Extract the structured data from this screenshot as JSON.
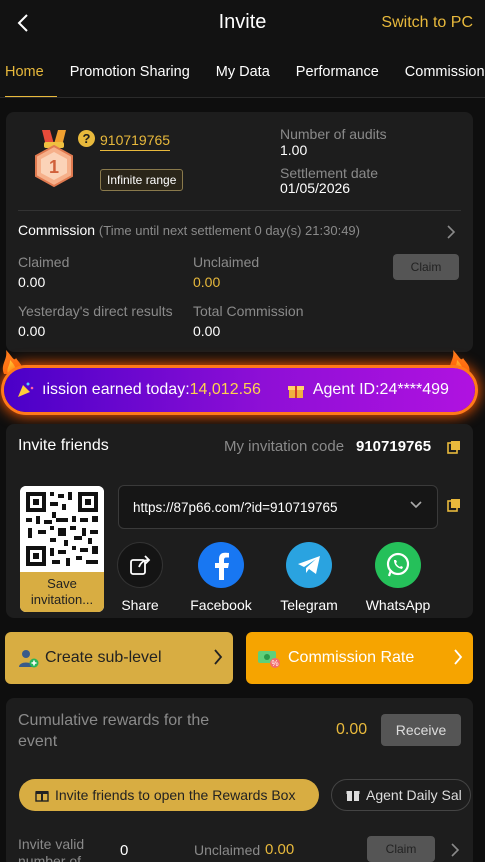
{
  "header": {
    "title": "Invite",
    "switch_label": "Switch to PC"
  },
  "tabs": [
    {
      "label": "Home",
      "active": true
    },
    {
      "label": "Promotion Sharing"
    },
    {
      "label": "My Data"
    },
    {
      "label": "Performance"
    },
    {
      "label": "Commission"
    }
  ],
  "profile": {
    "agent_id": "910719765",
    "range_badge": "Infinite range",
    "level": "1",
    "audits_label": "Number of audits",
    "audits_value": "1.00",
    "settlement_label": "Settlement date",
    "settlement_value": "01/05/2026"
  },
  "commission": {
    "title": "Commission",
    "countdown": "(Time until next settlement 0 day(s) 21:30:49)",
    "claimed_label": "Claimed",
    "claimed_value": "0.00",
    "unclaimed_label": "Unclaimed",
    "unclaimed_value": "0.00",
    "claim_button": "Claim",
    "yesterday_label": "Yesterday's direct results",
    "yesterday_value": "0.00",
    "total_label": "Total Commission",
    "total_value": "0.00"
  },
  "banner": {
    "earned_label": "ıission earned today:",
    "earned_value": "14,012.56",
    "agent_label": "Agent ID: ",
    "agent_value": "24****499"
  },
  "invite": {
    "title": "Invite friends",
    "code_label": "My invitation code",
    "code_value": "910719765",
    "link": "https://87p66.com/?id=910719765",
    "save_label": "Save invitation...",
    "share": [
      {
        "label": "Share",
        "icon": "share-icon"
      },
      {
        "label": "Facebook",
        "icon": "facebook-icon"
      },
      {
        "label": "Telegram",
        "icon": "telegram-icon"
      },
      {
        "label": "WhatsApp",
        "icon": "whatsapp-icon"
      }
    ]
  },
  "actions": {
    "create_sub": "Create sub-level",
    "commission_rate": "Commission Rate"
  },
  "rewards": {
    "cumulative_label": "Cumulative rewards for the event",
    "cumulative_value": "0.00",
    "receive_button": "Receive",
    "pill_a": "Invite friends to open the Rewards Box",
    "pill_b": "Agent Daily Sal",
    "invite_valid_label": "Invite valid number of...",
    "invite_valid_value": "0",
    "unclaimed_label": "Unclaimed",
    "unclaimed_value": "0.00",
    "claim_button": "Claim"
  },
  "colors": {
    "accent": "#e8b93c",
    "card": "#1d1d1d",
    "background": "#0e0e0e"
  }
}
